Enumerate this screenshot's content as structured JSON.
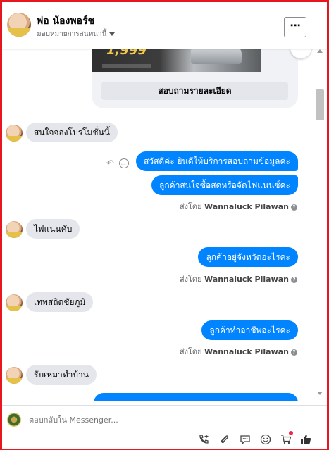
{
  "header": {
    "name": "พ่อ น้องพอร์ช",
    "assigned": "มอบหมายการสนทนานี้"
  },
  "card": {
    "price": "1,999",
    "button_label": "สอบถามรายละเอียด"
  },
  "messages": {
    "in1": "สนใจจองโปรโมชั่นนี้",
    "out1a": "สวัสดีค่ะ  ยินดีให้บริการสอบถามข้อมูลค่ะ",
    "out1b": "ลูกค้าสนใจซื้อสดหรือจัดไฟแนนซ์คะ",
    "in2": "ไฟแนนคับ",
    "out2": "ลูกค้าอยู่จังหวัดอะไรคะ",
    "in3": "เทพสถิตชัยภูมิ",
    "out3": "ลูกค้าทำอาชีพอะไรคะ",
    "in4": "รับเหมาทำบ้าน"
  },
  "sent_by": {
    "prefix": "ส่งโดย",
    "agent": "Wannaluck Pilawan",
    "info": "?"
  },
  "composer": {
    "placeholder": "ตอบกลับใน Messenger..."
  },
  "icons": {
    "more": "⋯",
    "reply": "↶",
    "add_call": "+",
    "attach": "paperclip",
    "saved_reply": "speech-bubble",
    "emoji": "smile",
    "cart": "cart",
    "like": "thumbs-up"
  },
  "colors": {
    "accent": "#0084ff",
    "frame": "#e8171f",
    "incoming": "#e4e6eb"
  }
}
